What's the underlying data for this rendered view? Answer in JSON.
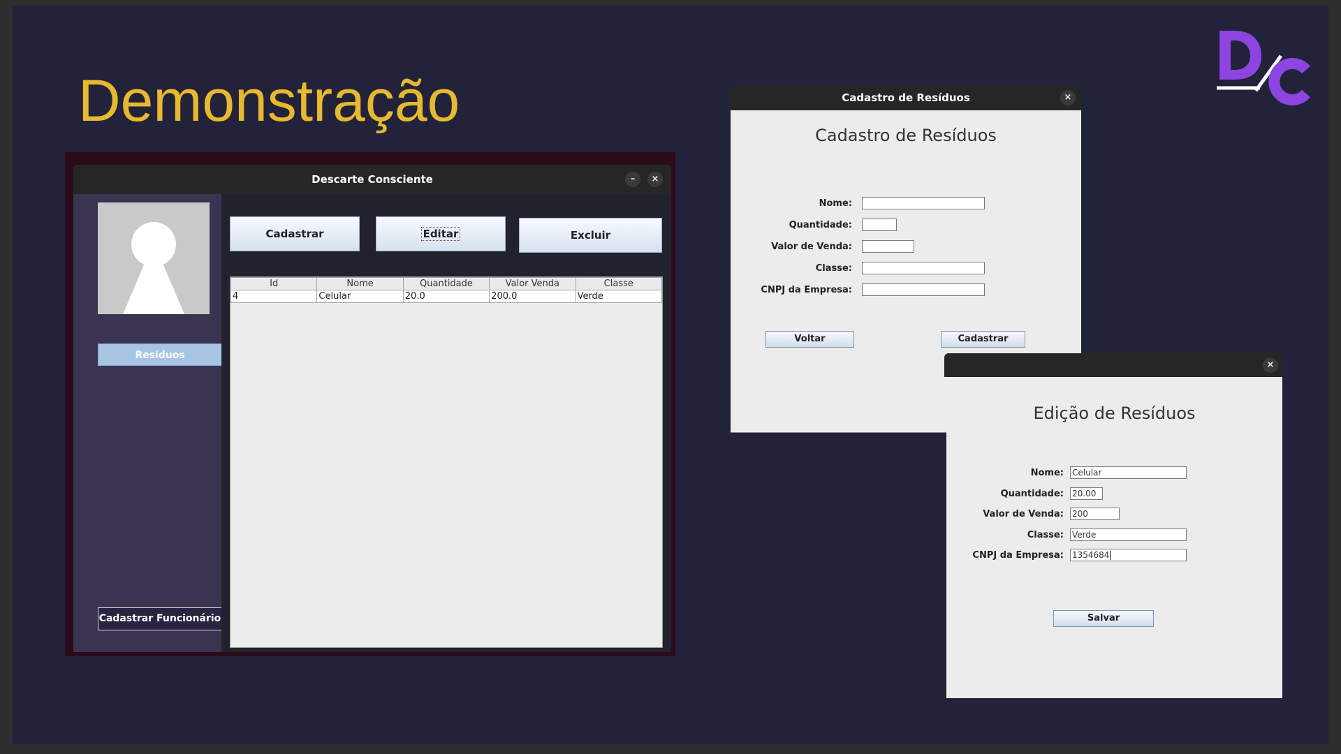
{
  "slide": {
    "title": "Demonstração",
    "logo_text": "D/C",
    "colors": {
      "background": "#22223a",
      "title": "#e6b92e",
      "logo": "#8e44e0"
    }
  },
  "main_window": {
    "title": "Descarte Consciente",
    "minimize_glyph": "–",
    "close_glyph": "×",
    "sidebar": {
      "avatar_icon": "user-silhouette-icon",
      "residuos_label": "Resíduos",
      "cadastrar_funcionario_label": "Cadastrar Funcionário"
    },
    "toolbar": {
      "cadastrar_label": "Cadastrar",
      "editar_label": "Editar",
      "excluir_label": "Excluir"
    },
    "table": {
      "columns": [
        "Id",
        "Nome",
        "Quantidade",
        "Valor Venda",
        "Classe"
      ],
      "rows": [
        [
          "4",
          "Celular",
          "20.0",
          "200.0",
          "Verde"
        ]
      ]
    }
  },
  "cadastro_window": {
    "title": "Cadastro de Resíduos",
    "close_glyph": "×",
    "heading": "Cadastro de Resíduos",
    "labels": {
      "nome": "Nome:",
      "quantidade": "Quantidade:",
      "valor_venda": "Valor de Venda:",
      "classe": "Classe:",
      "cnpj": "CNPJ da Empresa:"
    },
    "values": {
      "nome": "",
      "quantidade": "",
      "valor_venda": "",
      "classe": "",
      "cnpj": ""
    },
    "voltar_label": "Voltar",
    "cadastrar_label": "Cadastrar"
  },
  "edicao_window": {
    "title": "",
    "close_glyph": "×",
    "heading": "Edição de Resíduos",
    "labels": {
      "nome": "Nome:",
      "quantidade": "Quantidade:",
      "valor_venda": "Valor de Venda:",
      "classe": "Classe:",
      "cnpj": "CNPJ da Empresa:"
    },
    "values": {
      "nome": "Celular",
      "quantidade": "20.00",
      "valor_venda": "200",
      "classe": "Verde",
      "cnpj": "1354684"
    },
    "salvar_label": "Salvar"
  }
}
